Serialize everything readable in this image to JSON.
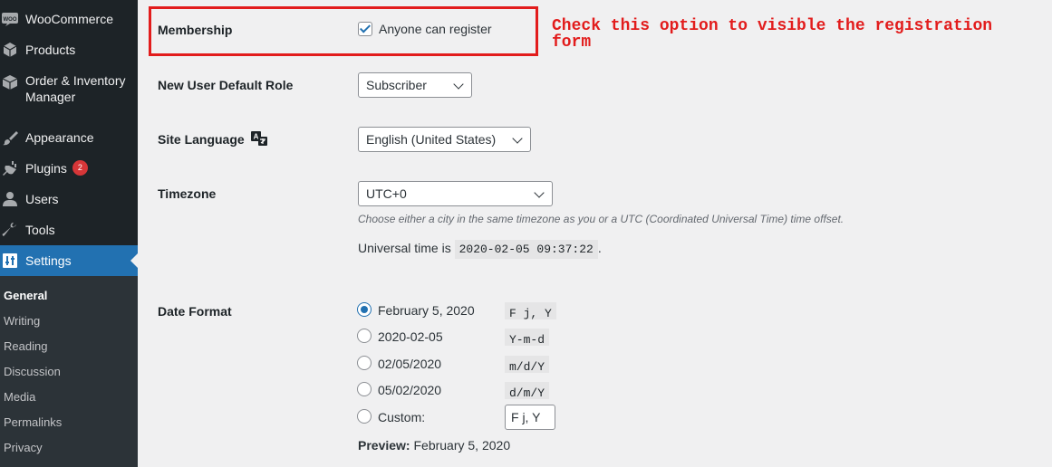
{
  "sidebar": {
    "items": [
      {
        "label": "WooCommerce",
        "icon": "woocommerce-icon"
      },
      {
        "label": "Products",
        "icon": "products-icon"
      },
      {
        "label": "Order & Inventory Manager",
        "icon": "box-icon"
      },
      {
        "label": "Appearance",
        "icon": "paintbrush-icon"
      },
      {
        "label": "Plugins",
        "icon": "plugin-icon",
        "badge": "2"
      },
      {
        "label": "Users",
        "icon": "user-icon"
      },
      {
        "label": "Tools",
        "icon": "wrench-icon"
      },
      {
        "label": "Settings",
        "icon": "settings-icon"
      }
    ],
    "submenu": [
      "General",
      "Writing",
      "Reading",
      "Discussion",
      "Media",
      "Permalinks",
      "Privacy"
    ],
    "active_submenu": "General"
  },
  "settings": {
    "membership": {
      "label": "Membership",
      "checkbox_label": "Anyone can register",
      "checked": true
    },
    "default_role": {
      "label": "New User Default Role",
      "value": "Subscriber"
    },
    "site_language": {
      "label": "Site Language",
      "value": "English (United States)"
    },
    "timezone": {
      "label": "Timezone",
      "value": "UTC+0",
      "help": "Choose either a city in the same timezone as you or a UTC (Coordinated Universal Time) time offset.",
      "universal_prefix": "Universal time is",
      "universal_value": "2020-02-05 09:37:22",
      "universal_suffix": "."
    },
    "date_format": {
      "label": "Date Format",
      "options": [
        {
          "label": "February 5, 2020",
          "code": "F j, Y",
          "checked": true
        },
        {
          "label": "2020-02-05",
          "code": "Y-m-d",
          "checked": false
        },
        {
          "label": "02/05/2020",
          "code": "m/d/Y",
          "checked": false
        },
        {
          "label": "05/02/2020",
          "code": "d/m/Y",
          "checked": false
        },
        {
          "label": "Custom:",
          "checked": false
        }
      ],
      "custom_value": "F j, Y",
      "preview_label": "Preview:",
      "preview_value": "February 5, 2020"
    }
  },
  "annotation": {
    "text": "Check this option to visible the registration form",
    "color": "#e21c1c"
  },
  "colors": {
    "accent": "#2271b1",
    "sidebar": "#1d2327",
    "badge": "#d63638"
  }
}
